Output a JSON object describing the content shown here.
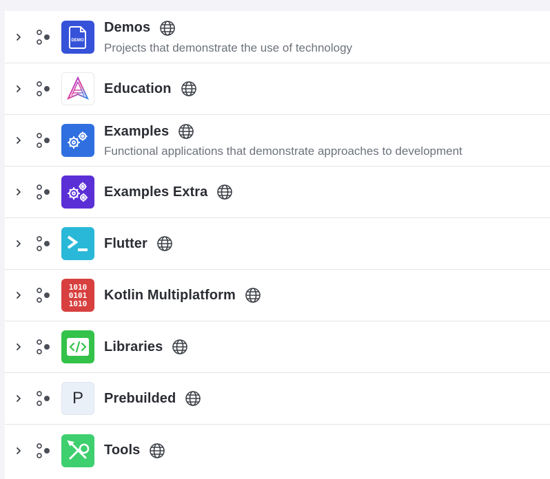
{
  "groups": [
    {
      "name": "Demos",
      "description": "Projects that demonstrate the use of technology",
      "icon": "demo-file-icon",
      "color": "#3652d9"
    },
    {
      "name": "Education",
      "description": "",
      "icon": "education-logo-icon",
      "color": "#ffffff"
    },
    {
      "name": "Examples",
      "description": "Functional applications that demonstrate approaches to development",
      "icon": "gears-icon",
      "color": "#2f6fe0"
    },
    {
      "name": "Examples Extra",
      "description": "",
      "icon": "gears-extra-icon",
      "color": "#5b2fd6"
    },
    {
      "name": "Flutter",
      "description": "",
      "icon": "terminal-prompt-icon",
      "color": "#2ab8d8"
    },
    {
      "name": "Kotlin Multiplatform",
      "description": "",
      "icon": "binary-code-icon",
      "color": "#d7403f"
    },
    {
      "name": "Libraries",
      "description": "",
      "icon": "code-tag-icon",
      "color": "#34c24a"
    },
    {
      "name": "Prebuilded",
      "description": "",
      "icon": "letter-p-icon",
      "icon_text": "P",
      "color": "#e9f0f8"
    },
    {
      "name": "Tools",
      "description": "",
      "icon": "wrench-screwdriver-icon",
      "color": "#3ecf6e"
    }
  ]
}
